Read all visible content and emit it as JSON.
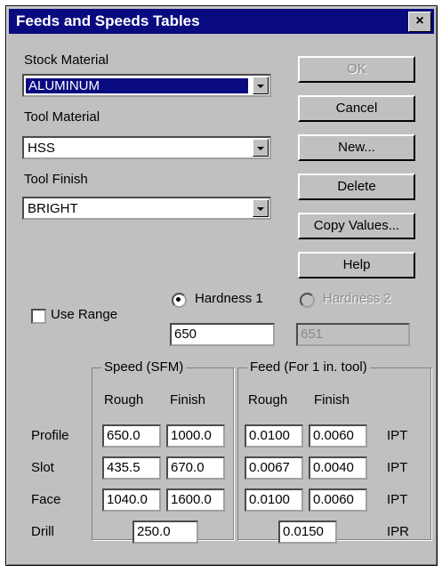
{
  "window": {
    "title": "Feeds and Speeds Tables",
    "close": "×"
  },
  "stock": {
    "label": "Stock Material",
    "value": "ALUMINUM"
  },
  "tool": {
    "label": "Tool Material",
    "value": "HSS"
  },
  "finish": {
    "label": "Tool Finish",
    "value": "BRIGHT"
  },
  "buttons": {
    "ok": "OK",
    "cancel": "Cancel",
    "new": "New...",
    "delete": "Delete",
    "copy": "Copy Values...",
    "help": "Help"
  },
  "use_range": {
    "label": "Use Range",
    "checked": false
  },
  "hardness1": {
    "label": "Hardness 1",
    "value": "650",
    "selected": true
  },
  "hardness2": {
    "label": "Hardness 2",
    "value": "651",
    "enabled": false
  },
  "speed_group": {
    "title": "Speed (SFM)",
    "rough": "Rough",
    "finish": "Finish"
  },
  "feed_group": {
    "title": "Feed (For 1 in. tool)",
    "rough": "Rough",
    "finish": "Finish"
  },
  "rows": {
    "profile": {
      "label": "Profile",
      "speed_rough": "650.0",
      "speed_finish": "1000.0",
      "feed_rough": "0.0100",
      "feed_finish": "0.0060",
      "unit": "IPT"
    },
    "slot": {
      "label": "Slot",
      "speed_rough": "435.5",
      "speed_finish": "670.0",
      "feed_rough": "0.0067",
      "feed_finish": "0.0040",
      "unit": "IPT"
    },
    "face": {
      "label": "Face",
      "speed_rough": "1040.0",
      "speed_finish": "1600.0",
      "feed_rough": "0.0100",
      "feed_finish": "0.0060",
      "unit": "IPT"
    },
    "drill": {
      "label": "Drill",
      "speed": "250.0",
      "feed": "0.0150",
      "unit": "IPR"
    }
  }
}
